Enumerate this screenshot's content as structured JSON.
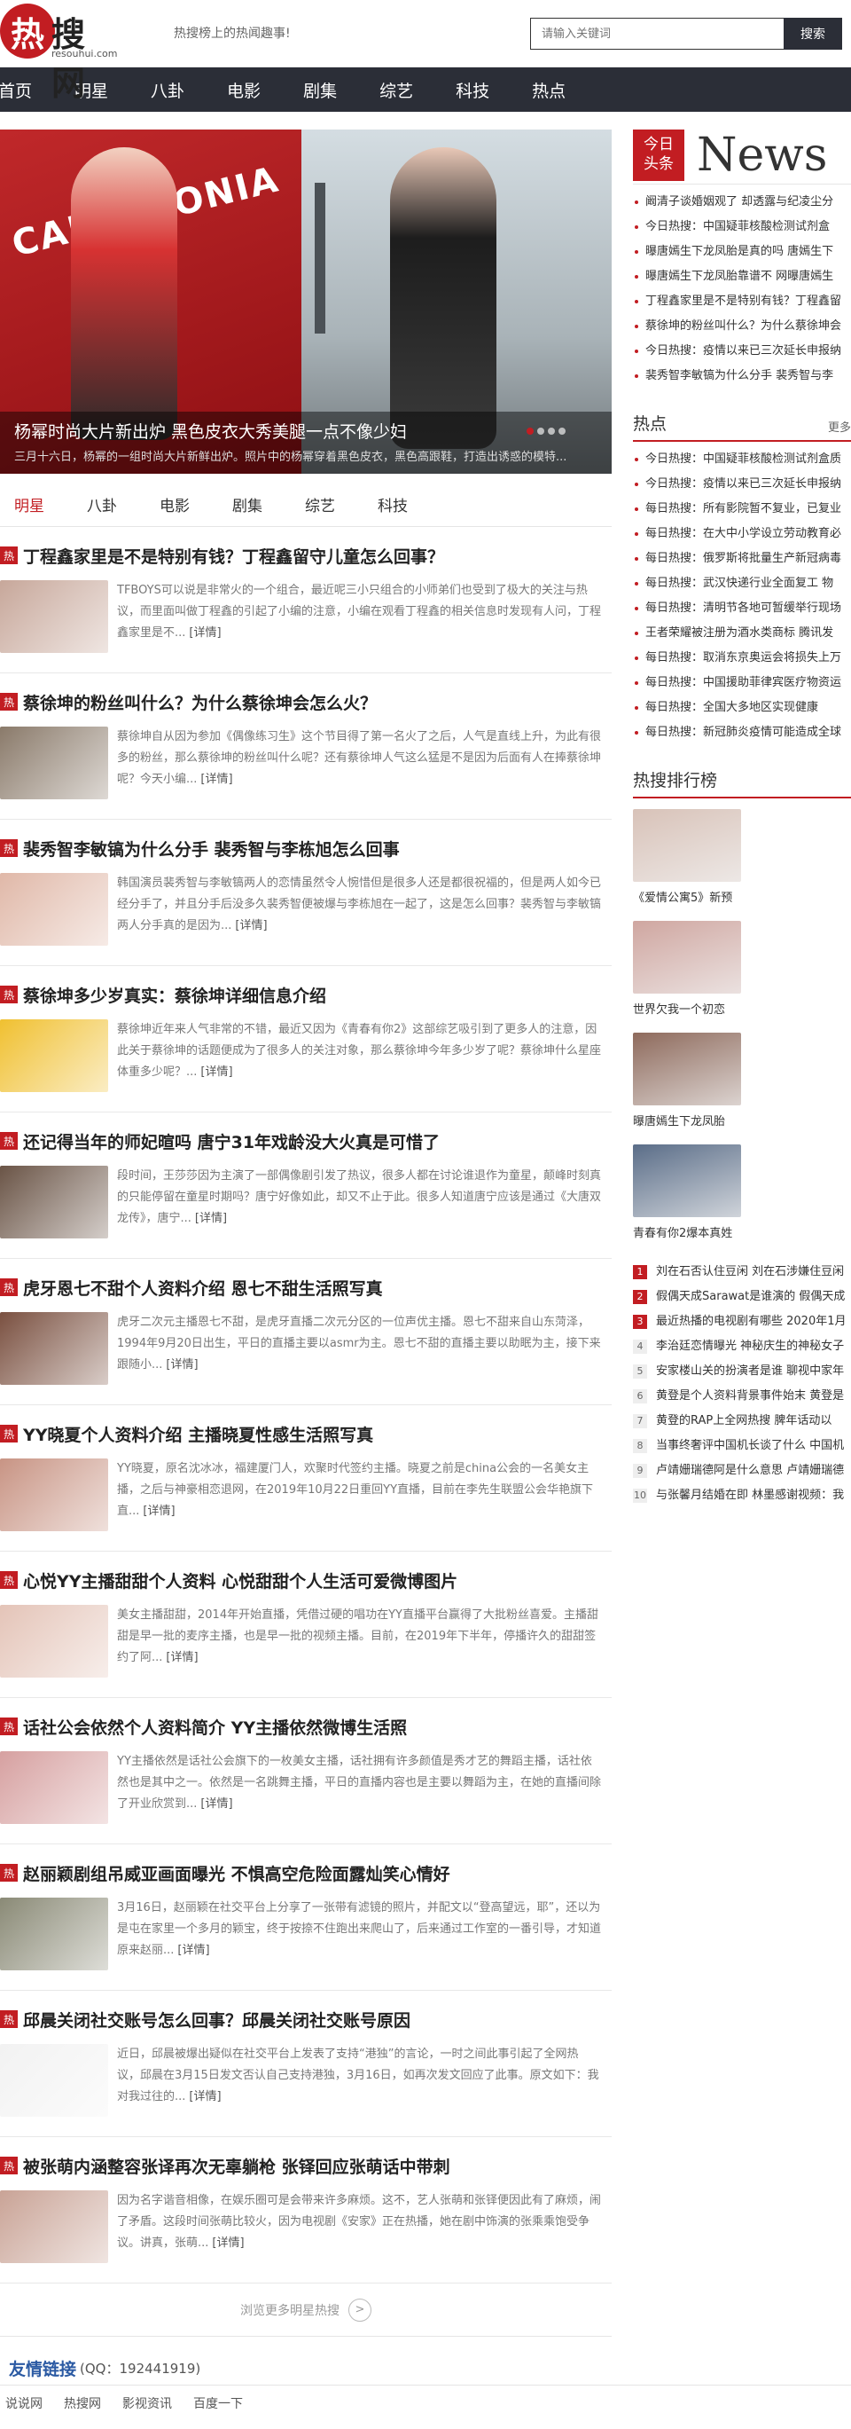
{
  "header": {
    "logo_char": "热",
    "logo_word": "搜网",
    "logo_domain": "resouhui.com",
    "slogan": "热搜榜上的热闻趣事!",
    "search_placeholder": "请输入关键词",
    "search_button": "搜索"
  },
  "nav": [
    "首页",
    "明星",
    "八卦",
    "电影",
    "剧集",
    "综艺",
    "科技",
    "热点"
  ],
  "slider": {
    "brand_text": "CALZEDONIA",
    "title": "杨幂时尚大片新出炉 黑色皮衣大秀美腿一点不像少妇",
    "summary": "三月十六日，杨幂的一组时尚大片新鲜出炉。照片中的杨幂穿着黑色皮衣，黑色高跟鞋，打造出诱惑的模特..."
  },
  "tabs": [
    "明星",
    "八卦",
    "电影",
    "剧集",
    "综艺",
    "科技"
  ],
  "articles": [
    {
      "tag": "热",
      "title": "丁程鑫家里是不是特别有钱？丁程鑫留守儿童怎么回事？",
      "desc": "TFBOYS可以说是非常火的一个组合，最近呢三小只组合的小师弟们也受到了极大的关注与热议，而里面叫做丁程鑫的引起了小编的注意，小编在观看丁程鑫的相关信息时发现有人问，丁程鑫家里是不...",
      "more": "[详情]",
      "color": "#c7a79a"
    },
    {
      "tag": "热",
      "title": "蔡徐坤的粉丝叫什么？为什么蔡徐坤会怎么火？",
      "desc": "蔡徐坤自从因为参加《偶像练习生》这个节目得了第一名火了之后，人气是直线上升，为此有很多的粉丝，那么蔡徐坤的粉丝叫什么呢？还有蔡徐坤人气这么猛是不是因为后面有人在捧蔡徐坤呢？今天小编...",
      "more": "[详情]",
      "color": "#8a7a6a"
    },
    {
      "tag": "热",
      "title": "裴秀智李敏镐为什么分手 裴秀智与李栋旭怎么回事",
      "desc": "韩国演员裴秀智与李敏镐两人的恋情虽然令人惋惜但是很多人还是都很祝福的，但是两人如今已经分手了，并且分手后没多久裴秀智便被爆与李栋旭在一起了，这是怎么回事？裴秀智与李敏镐两人分手真的是因为...",
      "more": "[详情]",
      "color": "#e0b8a8"
    },
    {
      "tag": "热",
      "title": "蔡徐坤多少岁真实：蔡徐坤详细信息介绍",
      "desc": "蔡徐坤近年来人气非常的不错，最近又因为《青春有你2》这部综艺吸引到了更多人的注意，因此关于蔡徐坤的话题便成为了很多人的关注对象，那么蔡徐坤今年多少岁了呢？蔡徐坤什么星座体重多少呢？...",
      "more": "[详情]",
      "color": "#f0c030"
    },
    {
      "tag": "热",
      "title": "还记得当年的师妃暄吗 唐宁31年戏龄没大火真是可惜了",
      "desc": "段时间，王莎莎因为主演了一部偶像剧引发了热议，很多人都在讨论谁退作为童星，颠峰时刻真的只能停留在童星时期吗？唐宁好像如此，却又不止于此。很多人知道唐宁应该是通过《大唐双龙传》，唐宁...",
      "more": "[详情]",
      "color": "#6a5446"
    },
    {
      "tag": "热",
      "title": "虎牙恩七不甜个人资料介绍 恩七不甜生活照写真",
      "desc": "虎牙二次元主播恩七不甜，是虎牙直播二次元分区的一位声优主播。恩七不甜来自山东菏泽，1994年9月20日出生，平日的直播主要以asmr为主。恩七不甜的直播主要以助眠为主，接下来跟随小...",
      "more": "[详情]",
      "color": "#7a5040"
    },
    {
      "tag": "热",
      "title": "YY晓夏个人资料介绍 主播晓夏性感生活照写真",
      "desc": "YY晓夏，原名沈冰冰，福建厦门人，欢聚时代签约主播。晓夏之前是china公会的一名美女主播，之后与神豪相恋退网，在2019年10月22日重回YY直播，目前在李先生联盟公会华艳旗下直...",
      "more": "[详情]",
      "color": "#c89484"
    },
    {
      "tag": "热",
      "title": "心悦YY主播甜甜个人资料 心悦甜甜个人生活可爱微博图片",
      "desc": "美女主播甜甜，2014年开始直播，凭借过硬的唱功在YY直播平台赢得了大批粉丝喜爱。主播甜甜是早一批的麦序主播，也是早一批的视频主播。目前，在2019年下半年，停播许久的甜甜签约了阿...",
      "more": "[详情]",
      "color": "#e4c4b8"
    },
    {
      "tag": "热",
      "title": "话社公会依然个人资料简介 YY主播依然微博生活照",
      "desc": "YY主播依然是话社公会旗下的一枚美女主播，话社拥有许多颜值是秀才艺的舞蹈主播，话社依然也是其中之一。依然是一名跳舞主播，平日的直播内容也是主要以舞蹈为主，在她的直播间除了开业欣赏到...",
      "more": "[详情]",
      "color": "#d6a0a0"
    },
    {
      "tag": "热",
      "title": "赵丽颖剧组吊威亚画面曝光 不惧高空危险面露灿笑心情好",
      "desc": "3月16日，赵丽颖在社交平台上分享了一张带有滤镜的照片，并配文以“登高望远，耶”，还以为是屯在家里一个多月的颖宝，终于按捺不住跑出来爬山了，后来通过工作室的一番引导，才知道原来赵丽...",
      "more": "[详情]",
      "color": "#8a8a76"
    },
    {
      "tag": "热",
      "title": "邱晨关闭社交账号怎么回事？邱晨关闭社交账号原因",
      "desc": "近日，邱晨被爆出疑似在社交平台上发表了支持“港独”的言论，一时之间此事引起了全网热议，邱晨在3月15日发文否认自己支持港独，3月16日，如再次发文回应了此事。原文如下：我对我过往的...",
      "more": "[详情]",
      "color": "#f2f2f2"
    },
    {
      "tag": "热",
      "title": "被张萌内涵整容张译再次无辜躺枪 张铎回应张萌话中带刺",
      "desc": "因为名字谐音相像，在娱乐圈可是会带来许多麻烦。这不，艺人张萌和张铎便因此有了麻烦，闹了矛盾。这段时间张萌比较火，因为电视剧《安家》正在热播，她在剧中饰演的张乘乘饱受争议。讲真，张萌...",
      "more": "[详情]",
      "color": "#c9a396"
    }
  ],
  "load_more": "浏览更多明星热搜",
  "side": {
    "badge_line1": "今日",
    "badge_line2": "头条",
    "big_word": "News",
    "news": [
      "阚清子谈婚姻观了 却透露与纪凌尘分",
      "今日热搜：中国疑菲核酸检测试剂盒",
      "曝唐嫣生下龙凤胎是真的吗 唐嫣生下",
      "曝唐嫣生下龙凤胎靠谱不 网曝唐嫣生",
      "丁程鑫家里是不是特别有钱？丁程鑫留",
      "蔡徐坤的粉丝叫什么？为什么蔡徐坤会",
      "今日热搜：疫情以来已三次延长申报纳",
      "裴秀智李敏镐为什么分手 裴秀智与李"
    ],
    "hot_title": "热点",
    "hot_more": "更多",
    "hot": [
      "今日热搜：中国疑菲核酸检测试剂盒质",
      "今日热搜：疫情以来已三次延长申报纳",
      "每日热搜：所有影院暂不复业，已复业",
      "每日热搜：在大中小学设立劳动教育必",
      "每日热搜：俄罗斯将批量生产新冠病毒",
      "每日热搜：武汉快递行业全面复工 物",
      "每日热搜：清明节各地可暂缓举行现场",
      "王者荣耀被注册为酒水类商标 腾讯发",
      "每日热搜：取消东京奥运会将损失上万",
      "每日热搜：中国援助菲律宾医疗物资运",
      "每日热搜：全国大多地区实现健康",
      "每日热搜：新冠肺炎疫情可能造成全球"
    ],
    "rank_title": "热搜排行榜",
    "pics": [
      {
        "cap": "《爱情公寓5》新预",
        "color": "#d8c2b8"
      },
      {
        "cap": "世界欠我一个初恋",
        "color": "#cfa6a0"
      },
      {
        "cap": "曝唐嫣生下龙凤胎",
        "color": "#8e6a5c"
      },
      {
        "cap": "青春有你2爆本真姓",
        "color": "#5a6d88"
      }
    ],
    "rank": [
      "刘在石否认住豆闲 刘在石涉嫌住豆闲",
      "假偶天成Sarawat是谁演的 假偶天成",
      "最近热播的电视剧有哪些 2020年1月",
      "李治廷恋情曝光 神秘庆生的神秘女子",
      "安家楼山关的扮演者是谁 聊视中家年",
      "黄登是个人资料背景事件始末 黄登是",
      "黄登的RAP上全网热搜 脾年话动以",
      "当事终奢评中国机长谈了什么 中国机",
      "卢靖姗瑞德阿是什么意思 卢靖姗瑞德",
      "与张馨月结婚在即 林墨感谢视频：我"
    ]
  },
  "links": {
    "title": "友情链接",
    "qq": "(QQ：192441919)",
    "items": [
      "说说网",
      "热搜网",
      "影视资讯",
      "百度一下"
    ]
  }
}
